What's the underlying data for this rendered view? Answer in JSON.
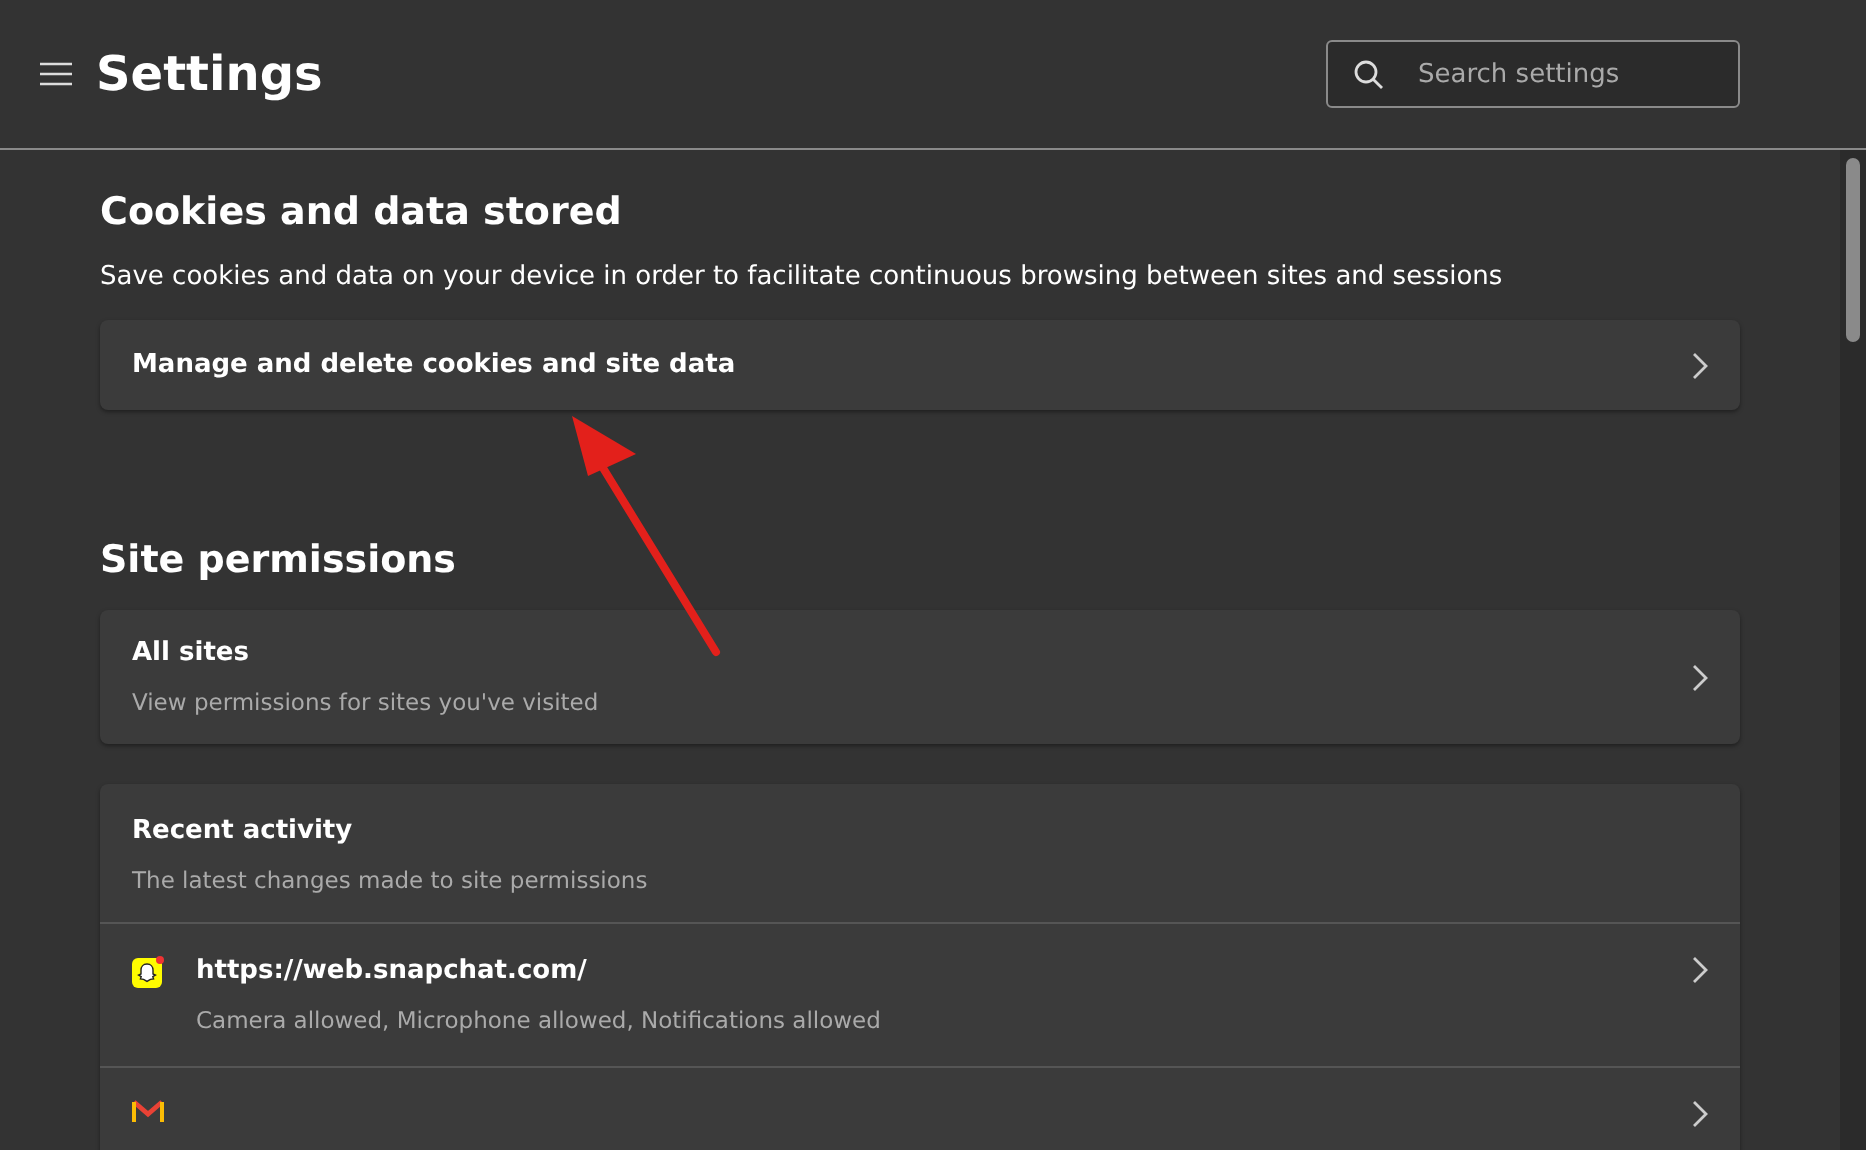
{
  "header": {
    "title": "Settings",
    "search": {
      "placeholder": "Search settings"
    }
  },
  "cookies": {
    "heading": "Cookies and data stored",
    "description": "Save cookies and data on your device in order to facilitate continuous browsing between sites and sessions",
    "link": "Manage and delete cookies and site data"
  },
  "permissions": {
    "heading": "Site permissions",
    "all_sites": {
      "title": "All sites",
      "subtitle": "View permissions for sites you've visited"
    },
    "recent_activity": {
      "title": "Recent activity",
      "subtitle": "The latest changes made to site permissions",
      "items": [
        {
          "kind": "snapchat",
          "url": "https://web.snapchat.com/",
          "detail": "Camera allowed, Microphone allowed, Notifications allowed"
        },
        {
          "kind": "mail"
        }
      ]
    }
  }
}
